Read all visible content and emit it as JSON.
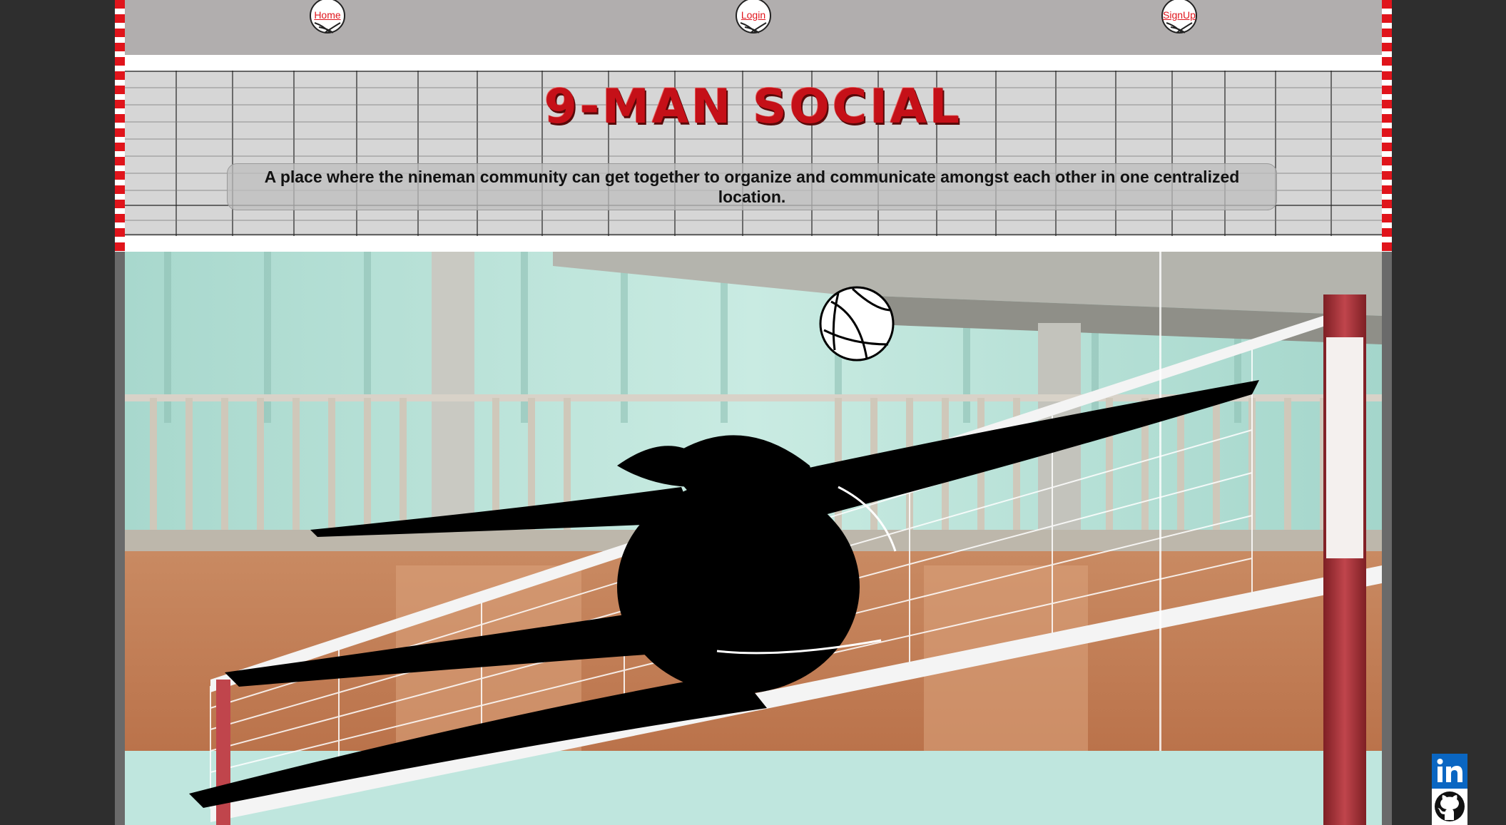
{
  "nav": {
    "items": [
      {
        "label": "Home"
      },
      {
        "label": "Login"
      },
      {
        "label": "SignUp"
      }
    ]
  },
  "header": {
    "logo_text": "9-MAN SOCIAL",
    "tagline": "A place where the nineman community can get together to organize and communicate amongst each other in one centralized location."
  },
  "hero": {
    "icons": [
      "volleyball-icon"
    ]
  },
  "social": {
    "icons": [
      "linkedin-icon",
      "github-icon"
    ]
  },
  "colors": {
    "accent": "#e0141b",
    "nav_bg": "#b1aeae",
    "page_bg": "#2e2e2e",
    "linkedin": "#0a66c2"
  }
}
